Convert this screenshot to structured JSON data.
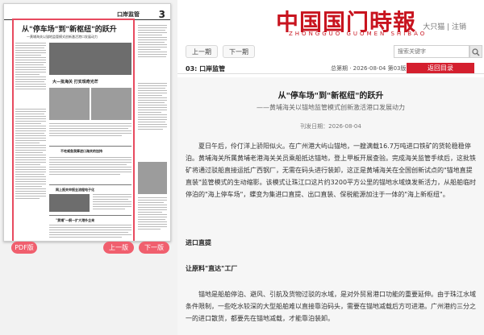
{
  "newspaper": {
    "header_date": "",
    "masthead": "",
    "section": "口岸监管",
    "page_number": "3",
    "lead_headline": "从\"停车场\"到\"新枢纽\"的跃升",
    "lead_subheadline": "—黄埔海关以锚地监管模式创新激活港口发展动力",
    "headlines": [
      "大—批海关  打实现奇光芒",
      "不吃咸鱼我算进口海关的加持",
      "网上报关申报全流程电子化",
      "\"黄埔\"一舸—扩大港外企来"
    ],
    "pdf_button": "PDF版",
    "prev_button": "上一版",
    "next_button": "下一版"
  },
  "site": {
    "logo": "中国国门時報",
    "logo_pinyin": "ZHONGGUO GUOMEN SHIBAO",
    "user_links": [
      "大只猫",
      "注销"
    ],
    "nav_prev": "上一期",
    "nav_next": "下一期",
    "search_placeholder": "搜索关键字",
    "search_icon": "search-icon"
  },
  "edition": {
    "page_label": "03: 口岸监管",
    "current_issue": "总第期 · 2026-08-04 第03版",
    "back_button": "返回目录"
  },
  "article": {
    "title": "从\"停车场\"到\"新枢纽\"的跃升",
    "subtitle": "——黄埔海关以锚地监管模式创新激活港口发展动力",
    "date": "刊发日期：2026-08-04",
    "paragraphs": [
      "夏日午后，伶仃洋上骄阳似火。在广州港大屿山锚地，一艘满载16.7万吨进口铁矿的货轮稳稳停泊。黄埔海关所属黄埔老港海关关员乘船抵达锚地，登上甲板开展查验。完成海关监管手续后，这批铁矿将通过驳船直接运抵广西钢厂，无需在码头进行装卸，这正是黄埔海关在全国创新试点的\"锚地直提直装\"监管模式的生动缩影。该模式让珠江口这片约3200平方公里的锚地水域焕发新活力，从船舶临时停泊的\"海上停车场\"，蝶变为集进口直提、出口直装、保税能源加注于一体的\"海上新枢纽\"。",
      "锚地是船舶停泊、避风、引航及货物过驳的水域，是对外贸易港口功能的重要延伸。由于珠江水域条件限制，一些吃水较深的大型船舶难以直接靠泊码头，需要在锚地减载后方可进港。广州港约三分之一的进口散货，都要先在锚地减载，才能靠泊装卸。"
    ],
    "heading1": "进口直提",
    "heading2": "让原料\"直达\"工厂"
  },
  "colors": {
    "brand_red": "#c8141f",
    "accent_pink": "#f05f6e",
    "back_red": "#d41f2e"
  }
}
